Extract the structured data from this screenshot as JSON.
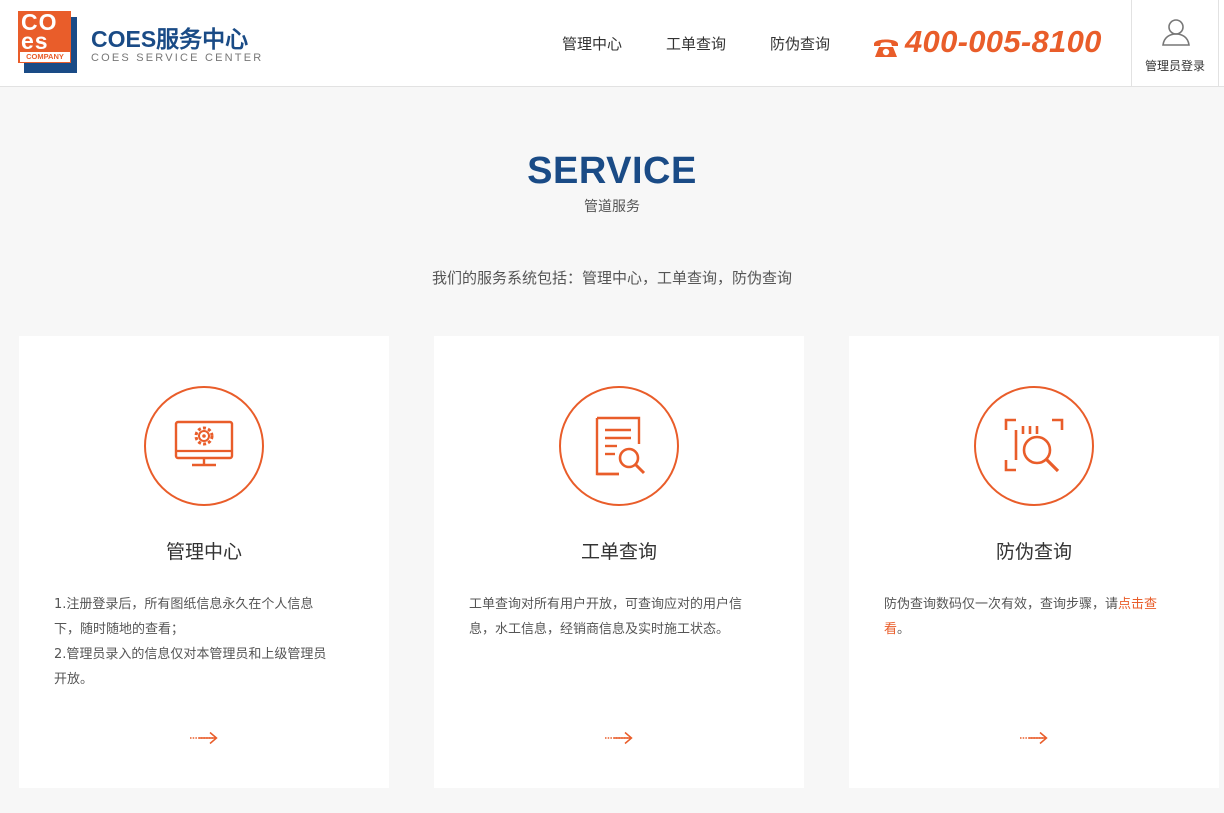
{
  "header": {
    "logo": {
      "line1": "CO",
      "line2": "es",
      "company": "COMPANY"
    },
    "brand_title": "COES服务中心",
    "brand_subtitle": "COES SERVICE CENTER",
    "nav": [
      {
        "label": "管理中心"
      },
      {
        "label": "工单查询"
      },
      {
        "label": "防伪查询"
      }
    ],
    "phone": "400-005-8100",
    "admin_login": "管理员登录"
  },
  "section": {
    "title": "SERVICE",
    "subtitle": "管道服务",
    "description": "我们的服务系统包括：管理中心，工单查询，防伪查询"
  },
  "cards": [
    {
      "icon": "monitor-gear-icon",
      "title": "管理中心",
      "lines": [
        "1.注册登录后，所有图纸信息永久在个人信息",
        "下，随时随地的查看；",
        "2.管理员录入的信息仅对本管理员和上级管理员",
        "开放。"
      ]
    },
    {
      "icon": "document-search-icon",
      "title": "工单查询",
      "lines": [
        "工单查询对所有用户开放，可查询应对的用户信",
        "息，水工信息，经销商信息及实时施工状态。"
      ]
    },
    {
      "icon": "scan-search-icon",
      "title": "防伪查询",
      "text_before": "防伪查询数码仅一次有效，查询步骤，请",
      "link_part1": "点击查",
      "link_part2": "看",
      "text_after": "。"
    }
  ],
  "colors": {
    "accent": "#e95d2a",
    "brand_blue": "#1a4b86",
    "background": "#f7f7f7"
  }
}
